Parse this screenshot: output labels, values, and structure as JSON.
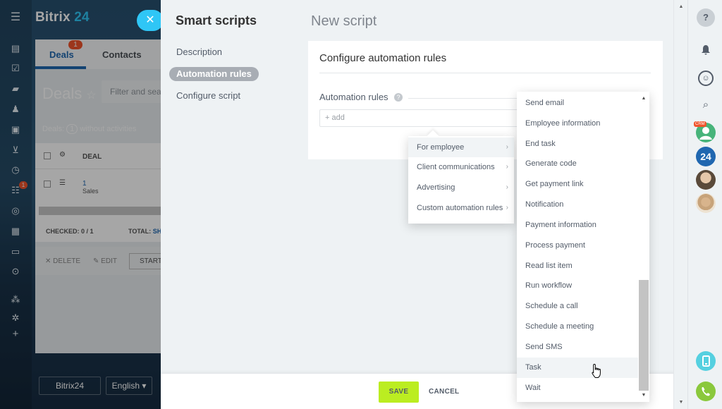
{
  "background_app": {
    "logo_text": "Bitrix",
    "logo_num": "24",
    "tabs": {
      "deals": "Deals",
      "contacts": "Contacts"
    },
    "deals_badge": "1",
    "deals_title": "Deals",
    "filter_placeholder": "Filter and sea",
    "deals_info": "Deals:",
    "deals_info_count": "1",
    "deals_info_suffix": "without activities",
    "table": {
      "header_deal": "DEAL",
      "row_id": "1",
      "row_stage": "Sales",
      "checked": "CHECKED: 0 / 1",
      "total": "TOTAL:",
      "total_link": "SHO"
    },
    "actions": {
      "delete": "DELETE",
      "edit": "EDIT",
      "start": "START"
    },
    "footer_bitrix": "Bitrix24",
    "footer_lang": "English",
    "sidebar_badge": "1"
  },
  "slider": {
    "nav_title": "Smart scripts",
    "nav_items": [
      {
        "label": "Description",
        "active": false
      },
      {
        "label": "Automation rules",
        "active": true
      },
      {
        "label": "Configure script",
        "active": false
      }
    ],
    "page_title": "New script",
    "card": {
      "title": "Configure automation rules",
      "rules_label": "Automation rules",
      "help_icon": "?",
      "add_label": "+ add"
    },
    "bottom": {
      "save": "SAVE",
      "cancel": "CANCEL"
    }
  },
  "menu_categories": [
    {
      "label": "For employee",
      "hovered": true
    },
    {
      "label": "Client communications",
      "hovered": false
    },
    {
      "label": "Advertising",
      "hovered": false
    },
    {
      "label": "Custom automation rules",
      "hovered": false
    }
  ],
  "menu_employee_items": [
    "Send email",
    "Employee information",
    "End task",
    "Generate code",
    "Get payment link",
    "Notification",
    "Payment information",
    "Process payment",
    "Read list item",
    "Run workflow",
    "Schedule a call",
    "Schedule a meeting",
    "Send SMS",
    "Task",
    "Wait"
  ],
  "hovered_item": "Task",
  "right_rail": {
    "crm_badge": "CRM",
    "bitrix_badge": "24"
  },
  "colors": {
    "accent_blue": "#2fc6f6",
    "save_green": "#bbed21",
    "badge_red": "#f0542c",
    "phone_green": "#55d0e0"
  }
}
